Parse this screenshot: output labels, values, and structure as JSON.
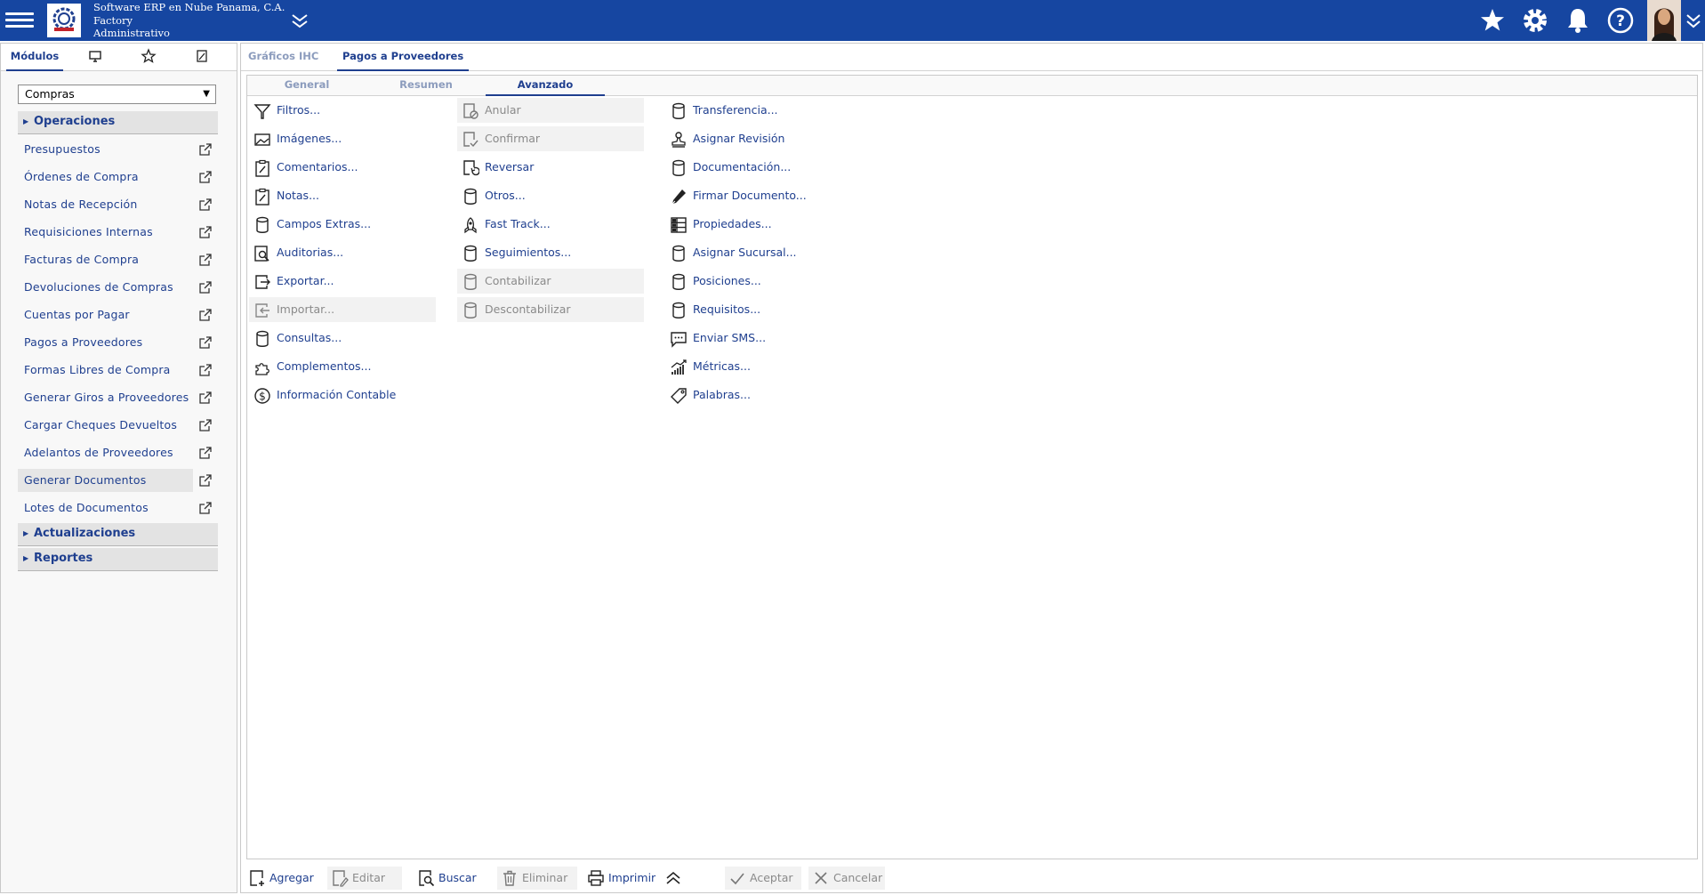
{
  "header": {
    "company_line1": "Software ERP en Nube Panama, C.A.",
    "company_line2": "Factory",
    "company_line3": "Administrativo",
    "icons": [
      "menu-icon",
      "collapse-icon",
      "star-icon",
      "gear-icon",
      "bell-icon",
      "help-icon",
      "chevron-down-icon"
    ]
  },
  "left": {
    "tabs": {
      "modulos": "Módulos"
    },
    "module_select": "Compras",
    "sections": {
      "operaciones": "Operaciones",
      "actualizaciones": "Actualizaciones",
      "reportes": "Reportes"
    },
    "items": [
      "Presupuestos",
      "Órdenes de Compra",
      "Notas de Recepción",
      "Requisiciones Internas",
      "Facturas de Compra",
      "Devoluciones de Compras",
      "Cuentas por Pagar",
      "Pagos a Proveedores",
      "Formas Libres de Compra",
      "Generar Giros a Proveedores",
      "Cargar Cheques Devueltos",
      "Adelantos de Proveedores",
      "Generar Documentos",
      "Lotes de Documentos"
    ]
  },
  "main": {
    "tabs": [
      "Gráficos IHC",
      "Pagos a Proveedores"
    ],
    "subtabs": [
      "General",
      "Resumen",
      "Avanzado"
    ],
    "col1": [
      "Filtros...",
      "Imágenes...",
      "Comentarios...",
      "Notas...",
      "Campos Extras...",
      "Auditorias...",
      "Exportar...",
      "Importar...",
      "Consultas...",
      "Complementos...",
      "Información Contable"
    ],
    "col2": [
      "Anular",
      "Confirmar",
      "Reversar",
      "Otros...",
      "Fast Track...",
      "Seguimientos...",
      "Contabilizar",
      "Descontabilizar"
    ],
    "col3": [
      "Transferencia...",
      "Asignar Revisión",
      "Documentación...",
      "Firmar Documento...",
      "Propiedades...",
      "Asignar Sucursal...",
      "Posiciones...",
      "Requisitos...",
      "Enviar SMS...",
      "Métricas...",
      "Palabras..."
    ]
  },
  "toolbar": {
    "agregar": "Agregar",
    "editar": "Editar",
    "buscar": "Buscar",
    "eliminar": "Eliminar",
    "imprimir": "Imprimir",
    "aceptar": "Aceptar",
    "cancelar": "Cancelar"
  },
  "colors": {
    "header_bg": "#1646a1",
    "link": "#1f3f8f",
    "disabled": "#8a8a8a"
  }
}
